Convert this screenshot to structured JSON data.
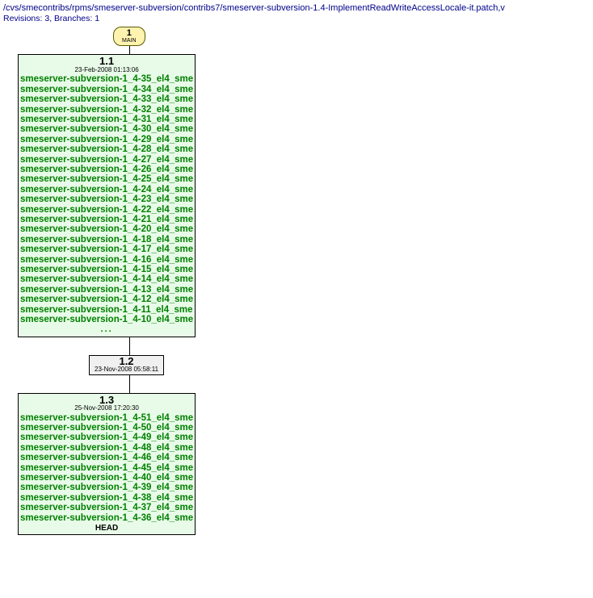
{
  "header": {
    "path": "/cvs/smecontribs/rpms/smeserver-subversion/contribs7/smeserver-subversion-1.4-ImplementReadWriteAccessLocale-it.patch,v",
    "meta": "Revisions: 3, Branches: 1"
  },
  "branch": {
    "number": "1",
    "name": "MAIN"
  },
  "rev11": {
    "rev": "1.1",
    "date": "23-Feb-2008 01:13:06",
    "tags": [
      "smeserver-subversion-1_4-35_el4_sme",
      "smeserver-subversion-1_4-34_el4_sme",
      "smeserver-subversion-1_4-33_el4_sme",
      "smeserver-subversion-1_4-32_el4_sme",
      "smeserver-subversion-1_4-31_el4_sme",
      "smeserver-subversion-1_4-30_el4_sme",
      "smeserver-subversion-1_4-29_el4_sme",
      "smeserver-subversion-1_4-28_el4_sme",
      "smeserver-subversion-1_4-27_el4_sme",
      "smeserver-subversion-1_4-26_el4_sme",
      "smeserver-subversion-1_4-25_el4_sme",
      "smeserver-subversion-1_4-24_el4_sme",
      "smeserver-subversion-1_4-23_el4_sme",
      "smeserver-subversion-1_4-22_el4_sme",
      "smeserver-subversion-1_4-21_el4_sme",
      "smeserver-subversion-1_4-20_el4_sme",
      "smeserver-subversion-1_4-18_el4_sme",
      "smeserver-subversion-1_4-17_el4_sme",
      "smeserver-subversion-1_4-16_el4_sme",
      "smeserver-subversion-1_4-15_el4_sme",
      "smeserver-subversion-1_4-14_el4_sme",
      "smeserver-subversion-1_4-13_el4_sme",
      "smeserver-subversion-1_4-12_el4_sme",
      "smeserver-subversion-1_4-11_el4_sme",
      "smeserver-subversion-1_4-10_el4_sme"
    ],
    "ellipsis": "..."
  },
  "rev12": {
    "rev": "1.2",
    "date": "23-Nov-2008 05:58:11"
  },
  "rev13": {
    "rev": "1.3",
    "date": "25-Nov-2008 17:20:30",
    "tags": [
      "smeserver-subversion-1_4-51_el4_sme",
      "smeserver-subversion-1_4-50_el4_sme",
      "smeserver-subversion-1_4-49_el4_sme",
      "smeserver-subversion-1_4-48_el4_sme",
      "smeserver-subversion-1_4-46_el4_sme",
      "smeserver-subversion-1_4-45_el4_sme",
      "smeserver-subversion-1_4-40_el4_sme",
      "smeserver-subversion-1_4-39_el4_sme",
      "smeserver-subversion-1_4-38_el4_sme",
      "smeserver-subversion-1_4-37_el4_sme",
      "smeserver-subversion-1_4-36_el4_sme"
    ],
    "head": "HEAD"
  }
}
